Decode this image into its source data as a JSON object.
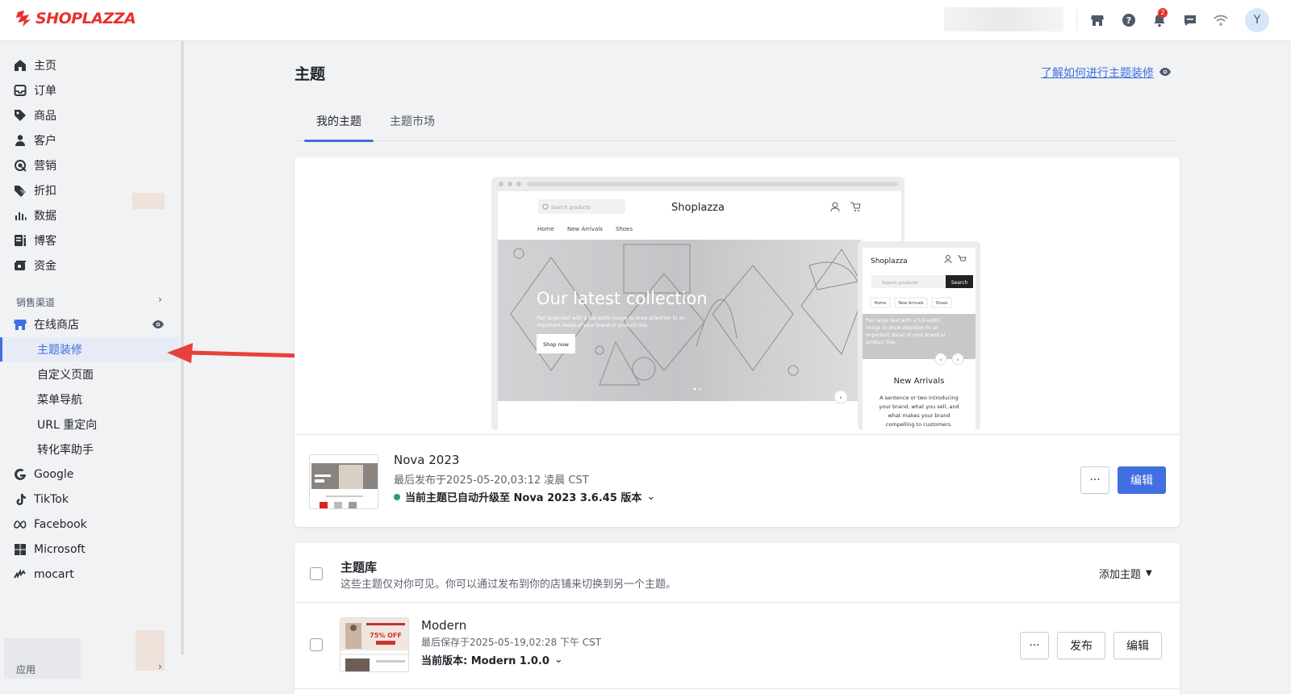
{
  "brand": {
    "logo_text": "SHOPLAZZA",
    "accent": "#3f6fe0",
    "logo_color": "#e8312f"
  },
  "topbar": {
    "icons": [
      "store-icon",
      "help-icon",
      "bell-icon",
      "message-icon",
      "wifi-icon"
    ],
    "notification_count": "2",
    "avatar_letter": "Y"
  },
  "sidebar": {
    "items": [
      {
        "label": "主页",
        "icon": "home-icon"
      },
      {
        "label": "订单",
        "icon": "inbox-icon"
      },
      {
        "label": "商品",
        "icon": "tag-icon"
      },
      {
        "label": "客户",
        "icon": "person-icon"
      },
      {
        "label": "营销",
        "icon": "target-icon"
      },
      {
        "label": "折扣",
        "icon": "discount-icon"
      },
      {
        "label": "数据",
        "icon": "bar-chart-icon"
      },
      {
        "label": "博客",
        "icon": "blog-icon"
      },
      {
        "label": "资金",
        "icon": "wallet-icon"
      }
    ],
    "sales_channels_title": "销售渠道",
    "online_store": "在线商店",
    "sub_items": [
      "主题装修",
      "自定义页面",
      "菜单导航",
      "URL 重定向",
      "转化率助手"
    ],
    "channels": [
      {
        "label": "Google",
        "icon": "google-icon"
      },
      {
        "label": "TikTok",
        "icon": "tiktok-icon"
      },
      {
        "label": "Facebook",
        "icon": "meta-icon"
      },
      {
        "label": "Microsoft",
        "icon": "microsoft-icon"
      },
      {
        "label": "mocart",
        "icon": "mocart-icon"
      }
    ],
    "apps_title": "应用"
  },
  "main": {
    "title": "主题",
    "help_link": "了解如何进行主题装修",
    "tabs": [
      "我的主题",
      "主题市场"
    ]
  },
  "preview": {
    "store_name": "Shoplazza",
    "search_placeholder": "Search products",
    "nav": [
      "Home",
      "New Arrivals",
      "Shoes"
    ],
    "hero_title": "Our latest collection",
    "hero_text": "Pair large text with a full-width image to draw attention to an important detail of your brand or product line.",
    "hero_button": "Shop now",
    "mobile_search_button": "Search",
    "mobile_section_title": "New Arrivals",
    "mobile_section_text": "A sentence or two introducing your brand, what you sell, and what makes your brand compelling to customers."
  },
  "current_theme": {
    "name": "Nova 2023",
    "published": "最后发布于2025-05-20,03:12 凌晨 CST",
    "version_status": "当前主题已自动升级至 Nova 2023 3.6.45 版本",
    "more_label": "···",
    "edit_label": "编辑"
  },
  "library": {
    "title": "主题库",
    "description": "这些主题仅对你可见。你可以通过发布到你的店铺来切换到另一个主题。",
    "add_label": "添加主题",
    "themes": [
      {
        "name": "Modern",
        "saved": "最后保存于2025-05-19,02:28 下午 CST",
        "version": "当前版本: Modern 1.0.0",
        "more_label": "···",
        "publish_label": "发布",
        "edit_label": "编辑",
        "thumb_promo": "75% OFF"
      }
    ]
  }
}
